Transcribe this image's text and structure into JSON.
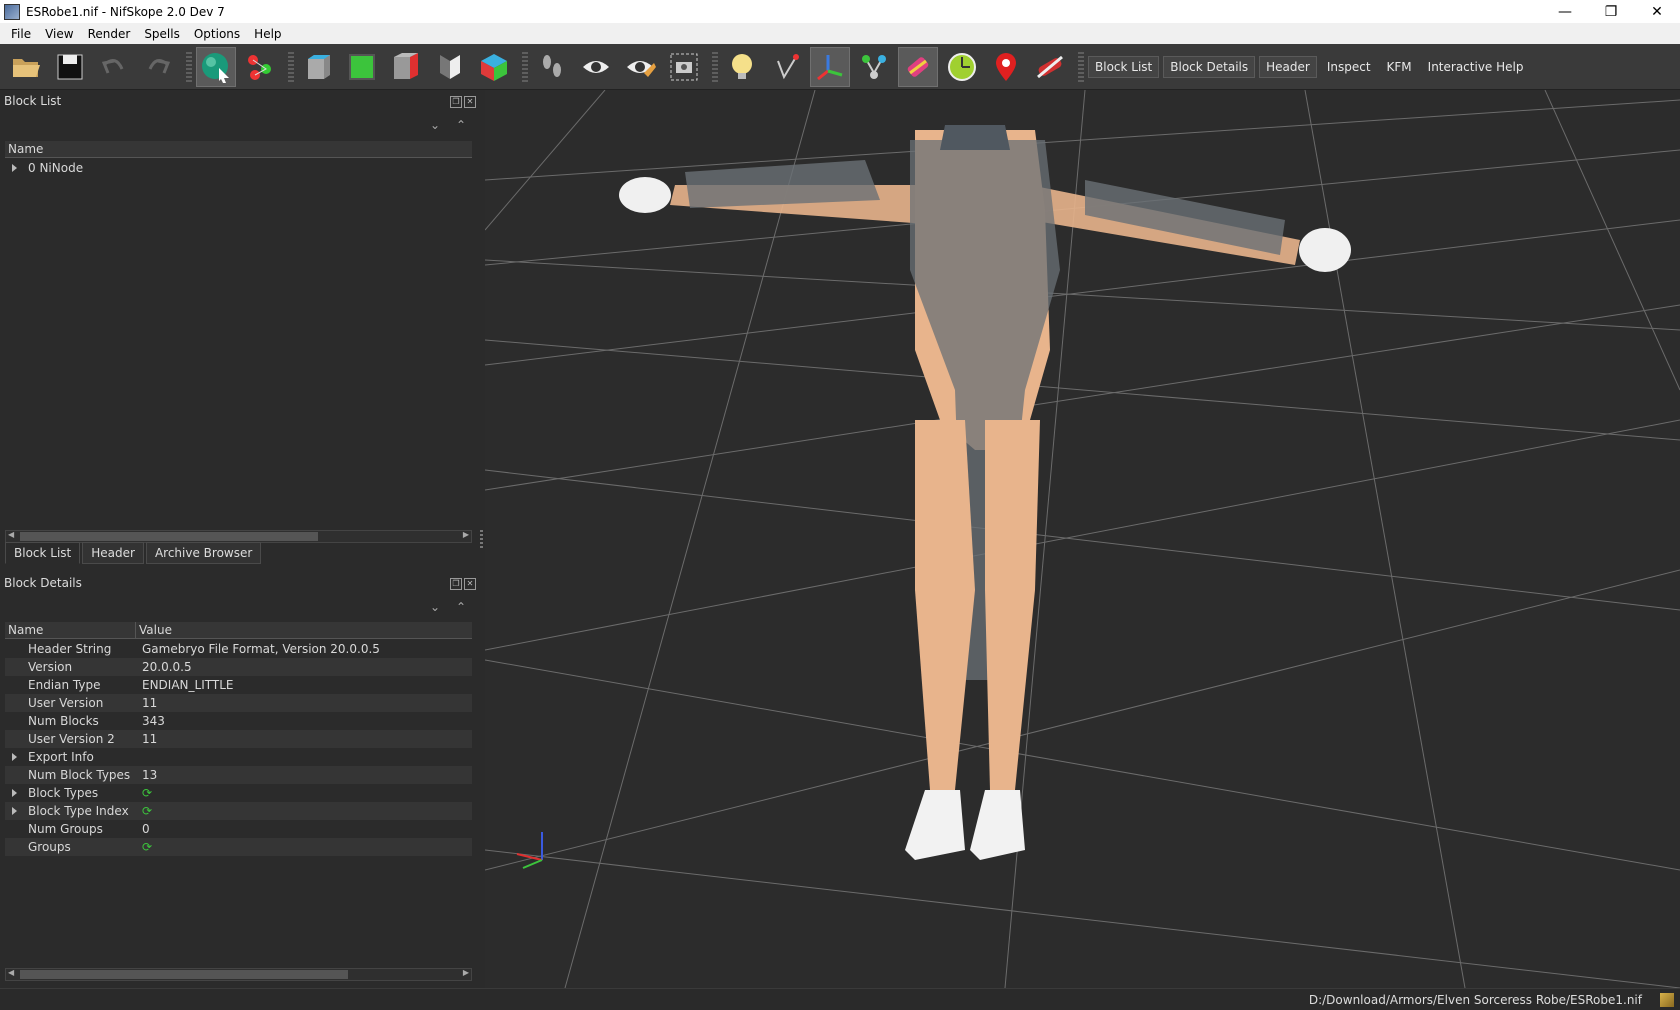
{
  "window": {
    "title": "ESRobe1.nif - NifSkope 2.0 Dev 7",
    "controls": [
      "—",
      "❐",
      "✕"
    ]
  },
  "menu": [
    "File",
    "View",
    "Render",
    "Spells",
    "Options",
    "Help"
  ],
  "toolbar": {
    "icons": [
      "open-icon",
      "save-icon",
      "undo-icon",
      "redo-icon",
      "select-mode-icon",
      "transform-icon",
      "view-front-icon",
      "view-green-cube-icon",
      "view-red-cube-icon",
      "view-flip-icon",
      "view-user-icon",
      "walk-icon",
      "show-icon",
      "show-hidden-icon",
      "screenshot-icon",
      "light-icon",
      "draw-axes-icon",
      "draw-axes-active-icon",
      "draw-nodes-icon",
      "draw-havok-icon",
      "draw-furniture-icon",
      "draw-markers-icon",
      "draw-constraints-icon"
    ],
    "dock_labels": [
      "Block List",
      "Block Details",
      "Header",
      "Inspect",
      "KFM",
      "Interactive Help"
    ]
  },
  "block_list": {
    "title": "Block List",
    "column_header": "Name",
    "rows": [
      {
        "label": "0 NiNode",
        "expandable": true
      }
    ]
  },
  "bottom_tabs": [
    "Block List",
    "Header",
    "Archive Browser"
  ],
  "block_details": {
    "title": "Block Details",
    "col_name": "Name",
    "col_value": "Value",
    "rows": [
      {
        "name": "Header String",
        "value": "Gamebryo File Format, Version 20.0.0.5",
        "expand": false,
        "icon": false
      },
      {
        "name": "Version",
        "value": "20.0.0.5",
        "expand": false,
        "icon": false
      },
      {
        "name": "Endian Type",
        "value": "ENDIAN_LITTLE",
        "expand": false,
        "icon": false
      },
      {
        "name": "User Version",
        "value": "11",
        "expand": false,
        "icon": false
      },
      {
        "name": "Num Blocks",
        "value": "343",
        "expand": false,
        "icon": false
      },
      {
        "name": "User Version 2",
        "value": "11",
        "expand": false,
        "icon": false
      },
      {
        "name": "Export Info",
        "value": "",
        "expand": true,
        "icon": false
      },
      {
        "name": "Num Block Types",
        "value": "13",
        "expand": false,
        "icon": false
      },
      {
        "name": "Block Types",
        "value": "",
        "expand": true,
        "icon": true
      },
      {
        "name": "Block Type Index",
        "value": "",
        "expand": true,
        "icon": true
      },
      {
        "name": "Num Groups",
        "value": "0",
        "expand": false,
        "icon": false
      },
      {
        "name": "Groups",
        "value": "",
        "expand": false,
        "icon": true
      }
    ]
  },
  "status": {
    "path": "D:/Download/Armors/Elven Sorceress Robe/ESRobe1.nif"
  },
  "colors": {
    "viewport_bg": "#2c2c2c",
    "grid": "#6b6b6b",
    "skin": "#e8b48c",
    "robe": "#6a7076",
    "accent_green": "#3cc43c"
  }
}
